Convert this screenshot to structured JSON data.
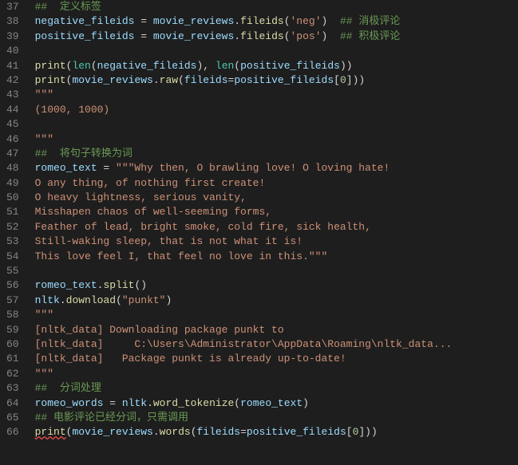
{
  "startLine": 37,
  "lines": [
    [
      {
        "cls": "comment",
        "text": "##  定义标签"
      }
    ],
    [
      {
        "cls": "identifier",
        "text": "negative_fileids"
      },
      {
        "cls": "op",
        "text": " = "
      },
      {
        "cls": "identifier",
        "text": "movie_reviews"
      },
      {
        "cls": "paren",
        "text": "."
      },
      {
        "cls": "call",
        "text": "fileids"
      },
      {
        "cls": "paren",
        "text": "("
      },
      {
        "cls": "string",
        "text": "'neg'"
      },
      {
        "cls": "paren",
        "text": ")"
      },
      {
        "cls": "",
        "text": "  "
      },
      {
        "cls": "comment",
        "text": "## 消极评论"
      }
    ],
    [
      {
        "cls": "identifier",
        "text": "positive_fileids"
      },
      {
        "cls": "op",
        "text": " = "
      },
      {
        "cls": "identifier",
        "text": "movie_reviews"
      },
      {
        "cls": "paren",
        "text": "."
      },
      {
        "cls": "call",
        "text": "fileids"
      },
      {
        "cls": "paren",
        "text": "("
      },
      {
        "cls": "string",
        "text": "'pos'"
      },
      {
        "cls": "paren",
        "text": ")"
      },
      {
        "cls": "",
        "text": "  "
      },
      {
        "cls": "comment",
        "text": "## 积极评论"
      }
    ],
    [
      {
        "cls": "",
        "text": ""
      }
    ],
    [
      {
        "cls": "call",
        "text": "print"
      },
      {
        "cls": "paren",
        "text": "("
      },
      {
        "cls": "builtin",
        "text": "len"
      },
      {
        "cls": "paren",
        "text": "("
      },
      {
        "cls": "identifier",
        "text": "negative_fileids"
      },
      {
        "cls": "paren",
        "text": "), "
      },
      {
        "cls": "builtin",
        "text": "len"
      },
      {
        "cls": "paren",
        "text": "("
      },
      {
        "cls": "identifier",
        "text": "positive_fileids"
      },
      {
        "cls": "paren",
        "text": "))"
      }
    ],
    [
      {
        "cls": "call",
        "text": "print"
      },
      {
        "cls": "paren",
        "text": "("
      },
      {
        "cls": "identifier",
        "text": "movie_reviews"
      },
      {
        "cls": "paren",
        "text": "."
      },
      {
        "cls": "call",
        "text": "raw"
      },
      {
        "cls": "paren",
        "text": "("
      },
      {
        "cls": "param",
        "text": "fileids"
      },
      {
        "cls": "op",
        "text": "="
      },
      {
        "cls": "identifier",
        "text": "positive_fileids"
      },
      {
        "cls": "paren",
        "text": "["
      },
      {
        "cls": "number",
        "text": "0"
      },
      {
        "cls": "paren",
        "text": "]))"
      }
    ],
    [
      {
        "cls": "string",
        "text": "\"\"\""
      }
    ],
    [
      {
        "cls": "string",
        "text": "(1000, 1000)"
      }
    ],
    [
      {
        "cls": "",
        "text": ""
      }
    ],
    [
      {
        "cls": "string",
        "text": "\"\"\""
      }
    ],
    [
      {
        "cls": "comment",
        "text": "##  将句子转换为词"
      }
    ],
    [
      {
        "cls": "identifier",
        "text": "romeo_text"
      },
      {
        "cls": "op",
        "text": " = "
      },
      {
        "cls": "string",
        "text": "\"\"\"Why then, O brawling love! O loving hate!"
      }
    ],
    [
      {
        "cls": "string",
        "text": "O any thing, of nothing first create!"
      }
    ],
    [
      {
        "cls": "string",
        "text": "O heavy lightness, serious vanity,"
      }
    ],
    [
      {
        "cls": "string",
        "text": "Misshapen chaos of well-seeming forms,"
      }
    ],
    [
      {
        "cls": "string",
        "text": "Feather of lead, bright smoke, cold fire, sick health,"
      }
    ],
    [
      {
        "cls": "string",
        "text": "Still-waking sleep, that is not what it is!"
      }
    ],
    [
      {
        "cls": "string",
        "text": "This love feel I, that feel no love in this.\"\"\""
      }
    ],
    [
      {
        "cls": "",
        "text": ""
      }
    ],
    [
      {
        "cls": "identifier",
        "text": "romeo_text"
      },
      {
        "cls": "paren",
        "text": "."
      },
      {
        "cls": "call",
        "text": "split"
      },
      {
        "cls": "paren",
        "text": "()"
      }
    ],
    [
      {
        "cls": "identifier",
        "text": "nltk"
      },
      {
        "cls": "paren",
        "text": "."
      },
      {
        "cls": "call",
        "text": "download"
      },
      {
        "cls": "paren",
        "text": "("
      },
      {
        "cls": "string",
        "text": "\"punkt\""
      },
      {
        "cls": "paren",
        "text": ")"
      }
    ],
    [
      {
        "cls": "string",
        "text": "\"\"\""
      }
    ],
    [
      {
        "cls": "string",
        "text": "[nltk_data] Downloading package punkt to"
      }
    ],
    [
      {
        "cls": "string",
        "text": "[nltk_data]     C:\\Users\\Administrator\\AppData\\Roaming\\nltk_data..."
      }
    ],
    [
      {
        "cls": "string",
        "text": "[nltk_data]   Package punkt is already up-to-date!"
      }
    ],
    [
      {
        "cls": "string",
        "text": "\"\"\""
      }
    ],
    [
      {
        "cls": "comment",
        "text": "##  分词处理"
      }
    ],
    [
      {
        "cls": "identifier",
        "text": "romeo_words"
      },
      {
        "cls": "op",
        "text": " = "
      },
      {
        "cls": "identifier",
        "text": "nltk"
      },
      {
        "cls": "paren",
        "text": "."
      },
      {
        "cls": "call",
        "text": "word_tokenize"
      },
      {
        "cls": "paren",
        "text": "("
      },
      {
        "cls": "identifier",
        "text": "romeo_text"
      },
      {
        "cls": "paren",
        "text": ")"
      }
    ],
    [
      {
        "cls": "comment",
        "text": "## 电影评论已经分词，只需调用"
      }
    ],
    [
      {
        "cls": "call underline-error",
        "text": "print"
      },
      {
        "cls": "paren",
        "text": "("
      },
      {
        "cls": "identifier",
        "text": "movie_reviews"
      },
      {
        "cls": "paren",
        "text": "."
      },
      {
        "cls": "call",
        "text": "words"
      },
      {
        "cls": "paren",
        "text": "("
      },
      {
        "cls": "param",
        "text": "fileids"
      },
      {
        "cls": "op",
        "text": "="
      },
      {
        "cls": "identifier",
        "text": "positive_fileids"
      },
      {
        "cls": "paren",
        "text": "["
      },
      {
        "cls": "number",
        "text": "0"
      },
      {
        "cls": "paren",
        "text": "]))"
      }
    ]
  ]
}
